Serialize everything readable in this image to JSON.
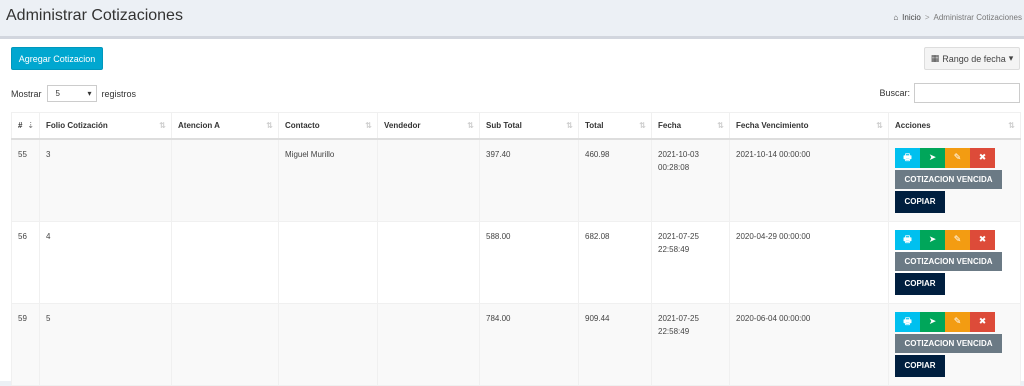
{
  "header": {
    "title": "Administrar Cotizaciones",
    "crumb_home": "Inicio",
    "crumb_sep": ">",
    "crumb_current": "Administrar Cotizaciones"
  },
  "toolbar": {
    "add_label": "Agregar Cotizacion",
    "range_label": "Rango de fecha"
  },
  "controls": {
    "show_label": "Mostrar",
    "show_value": "5",
    "records_label": "registros",
    "search_label": "Buscar:",
    "search_value": ""
  },
  "table": {
    "columns": [
      "#",
      "Folio Cotización",
      "Atencion A",
      "Contacto",
      "Vendedor",
      "Sub Total",
      "Total",
      "Fecha",
      "Fecha Vencimiento",
      "Acciones"
    ],
    "rows": [
      {
        "id": "55",
        "folio": "3",
        "atencion": "",
        "contacto": "Miguel Murillo",
        "vendedor": "",
        "subtotal": "397.40",
        "total": "460.98",
        "fecha_date": "2021-10-03",
        "fecha_time": "00:28:08",
        "vencimiento": "2021-10-14 00:00:00"
      },
      {
        "id": "56",
        "folio": "4",
        "atencion": "",
        "contacto": "",
        "vendedor": "",
        "subtotal": "588.00",
        "total": "682.08",
        "fecha_date": "2021-07-25",
        "fecha_time": "22:58:49",
        "vencimiento": "2020-04-29 00:00:00"
      },
      {
        "id": "59",
        "folio": "5",
        "atencion": "",
        "contacto": "",
        "vendedor": "",
        "subtotal": "784.00",
        "total": "909.44",
        "fecha_date": "2021-07-25",
        "fecha_time": "22:58:49",
        "vencimiento": "2020-06-04 00:00:00"
      }
    ],
    "status_label": "COTIZACION VENCIDA",
    "copy_label": "COPIAR"
  },
  "icons": {
    "sort": "⇅",
    "sort_asc": "⇣",
    "print": "🖶",
    "send": "➤",
    "edit": "✎",
    "delete": "✖",
    "home": "⌂",
    "calendar": "▦",
    "caret": "▾"
  },
  "colors": {
    "accent": "#00a7d0",
    "print": "#00c0ef",
    "send": "#00a65a",
    "edit": "#f39c12",
    "delete": "#dd4b39",
    "status": "#6b7a85",
    "copy": "#001f3f"
  }
}
